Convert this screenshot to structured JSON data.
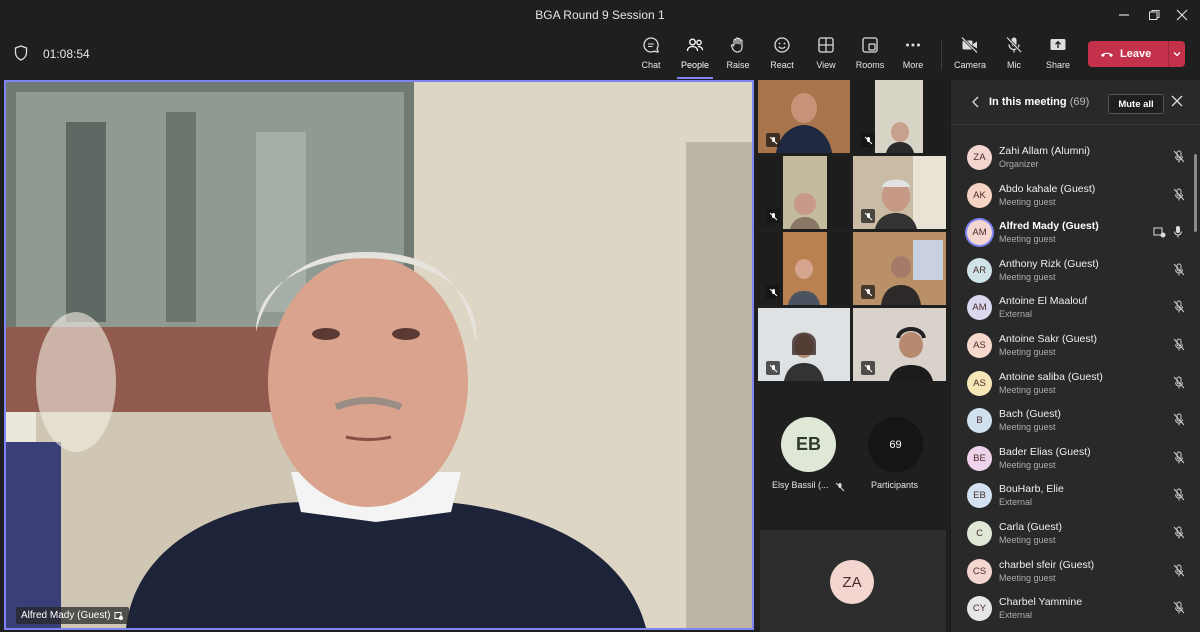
{
  "window": {
    "title": "BGA Round 9 Session 1"
  },
  "toolbar": {
    "timer": "01:08:54",
    "buttons": [
      {
        "label": "Chat",
        "icon": "chat-icon"
      },
      {
        "label": "People",
        "icon": "people-icon"
      },
      {
        "label": "Raise",
        "icon": "raise-hand-icon"
      },
      {
        "label": "React",
        "icon": "react-icon"
      },
      {
        "label": "View",
        "icon": "view-icon"
      },
      {
        "label": "Rooms",
        "icon": "rooms-icon"
      },
      {
        "label": "More",
        "icon": "more-icon"
      },
      {
        "label": "Camera",
        "icon": "camera-off-icon"
      },
      {
        "label": "Mic",
        "icon": "mic-off-icon"
      },
      {
        "label": "Share",
        "icon": "share-icon"
      }
    ],
    "active": "People",
    "leave_label": "Leave"
  },
  "main_video": {
    "name": "Alfred Mady (Guest)"
  },
  "gallery": {
    "avatar_initials": "EB",
    "avatar_name": "Elsy Bassil (...",
    "participants_count": "69",
    "participants_label": "Participants",
    "bottom_initials": "ZA"
  },
  "people_panel": {
    "title": "In this meeting",
    "count": "(69)",
    "mute_all": "Mute all",
    "participants": [
      {
        "initials": "ZA",
        "name": "Zahi Allam (Alumni)",
        "role": "Organizer",
        "color": "#f3d6d0"
      },
      {
        "initials": "AK",
        "name": "Abdo kahale (Guest)",
        "role": "Meeting guest",
        "color": "#f6d3c5"
      },
      {
        "initials": "AM",
        "name": "Alfred Mady (Guest)",
        "role": "Meeting guest",
        "color": "#f3d6d0"
      },
      {
        "initials": "AR",
        "name": "Anthony Rizk (Guest)",
        "role": "Meeting guest",
        "color": "#cfe3e6"
      },
      {
        "initials": "AM",
        "name": "Antoine El Maalouf",
        "role": "External",
        "color": "#d9d8ef"
      },
      {
        "initials": "AS",
        "name": "Antoine Sakr (Guest)",
        "role": "Meeting guest",
        "color": "#f6d8cc"
      },
      {
        "initials": "AS",
        "name": "Antoine saliba (Guest)",
        "role": "Meeting guest",
        "color": "#f7e6b8"
      },
      {
        "initials": "B",
        "name": "Bach (Guest)",
        "role": "Meeting guest",
        "color": "#cfe0ee"
      },
      {
        "initials": "BE",
        "name": "Bader Elias (Guest)",
        "role": "Meeting guest",
        "color": "#efd3ea"
      },
      {
        "initials": "EB",
        "name": "BouHarb, Elie",
        "role": "External",
        "color": "#d3e1f0"
      },
      {
        "initials": "C",
        "name": "Carla (Guest)",
        "role": "Meeting guest",
        "color": "#dfe8d6"
      },
      {
        "initials": "CS",
        "name": "charbel sfeir (Guest)",
        "role": "Meeting guest",
        "color": "#f3d6d0"
      },
      {
        "initials": "CY",
        "name": "Charbel Yammine",
        "role": "External",
        "color": "#e6e6e6"
      }
    ]
  }
}
